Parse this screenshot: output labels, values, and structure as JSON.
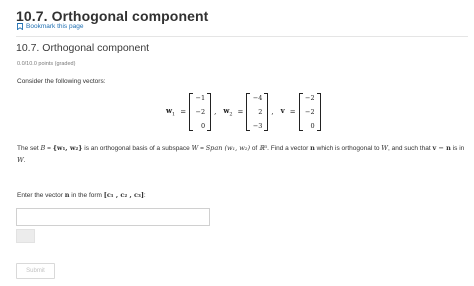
{
  "header": {
    "title": "10.7. Orthogonal component",
    "bookmark_label": "Bookmark this page"
  },
  "problem": {
    "title": "10.7. Orthogonal component",
    "points": "0.0/10.0 points (graded)",
    "intro": "Consider the following vectors:",
    "vectors": [
      {
        "name": "w",
        "sub": "1",
        "entries": [
          "−1",
          "−2",
          "0"
        ]
      },
      {
        "name": "w",
        "sub": "2",
        "entries": [
          "−4",
          "2",
          "−3"
        ]
      },
      {
        "name": "v",
        "sub": "",
        "entries": [
          "−2",
          "−2",
          "0"
        ]
      }
    ],
    "statement": {
      "t1": "The set ",
      "B": "B",
      "eq1": " = ",
      "set": "{w₁, w₂}",
      "t2": " is an orthogonal basis of a subspace ",
      "W": "W",
      "eq2": " = ",
      "span": "Span (w₁, w₂)",
      "t3": " of ",
      "R3": "ℝ³",
      "t4": ". Find a vector ",
      "n": "n",
      "t5": " which is orthogonal to ",
      "W2": "W",
      "t6": ", and such that ",
      "vn": "v − n",
      "t7": " is in ",
      "W3": "W",
      "t8": "."
    },
    "prompt_text": "Enter the vector ",
    "prompt_n": "n",
    "prompt_mid": " in the form ",
    "prompt_form": "[c₁ , c₂ , c₃]",
    "prompt_end": ":",
    "answer_value": "",
    "submit_label": "Submit"
  },
  "colors": {
    "link": "#1f6fb2",
    "disabled_text": "#c2c2c2"
  },
  "icons": {
    "bookmark": "bookmark-icon"
  }
}
